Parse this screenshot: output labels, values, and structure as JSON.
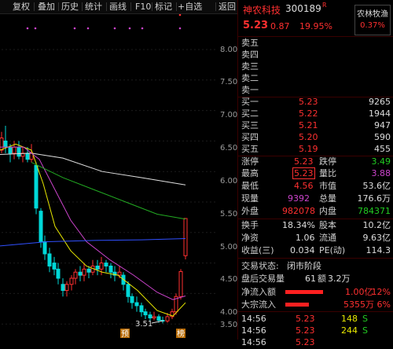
{
  "toolbar": {
    "items": [
      "复权",
      "叠加",
      "历史",
      "统计",
      "画线",
      "F10",
      "标记",
      "+自选",
      "返回"
    ]
  },
  "chart": {
    "y_ticks": [
      "8.00",
      "7.50",
      "7.00",
      "6.50",
      "6.00",
      "5.50",
      "5.00",
      "4.50",
      "4.00",
      "3.50"
    ],
    "low_label": "3.51",
    "badge_yu": "预",
    "badge_bang": "榜",
    "colors": {
      "up": "#ff3030",
      "down": "#00d8d8",
      "ma_white": "#e0e0e0",
      "ma_yellow": "#e8e800",
      "ma_purple": "#cc44cc",
      "ma_green": "#22aa22",
      "ma_blue": "#3050ff"
    }
  },
  "quote": {
    "name": "神农科技",
    "code": "300189",
    "r_mark": "R",
    "sector_name": "农林牧渔",
    "sector_pct": "0.37%",
    "price": "5.23",
    "change": "0.87",
    "change_pct": "19.95%"
  },
  "order_book": {
    "sells": [
      {
        "label": "卖五",
        "price": "",
        "vol": ""
      },
      {
        "label": "卖四",
        "price": "",
        "vol": ""
      },
      {
        "label": "卖三",
        "price": "",
        "vol": ""
      },
      {
        "label": "卖二",
        "price": "",
        "vol": ""
      },
      {
        "label": "卖一",
        "price": "",
        "vol": ""
      }
    ],
    "buys": [
      {
        "label": "买一",
        "price": "5.23",
        "vol": "9265"
      },
      {
        "label": "买二",
        "price": "5.22",
        "vol": "1944"
      },
      {
        "label": "买三",
        "price": "5.21",
        "vol": "947"
      },
      {
        "label": "买四",
        "price": "5.20",
        "vol": "590"
      },
      {
        "label": "买五",
        "price": "5.19",
        "vol": "455"
      }
    ]
  },
  "stats": {
    "limit_up_label": "涨停",
    "limit_up": "5.23",
    "limit_down_label": "跌停",
    "limit_down": "3.49",
    "high_label": "最高",
    "high": "5.23",
    "vol_ratio_label": "量比",
    "vol_ratio": "3.88",
    "low_label": "最低",
    "low": "4.56",
    "mkt_cap_label": "市值",
    "mkt_cap": "53.6亿",
    "now_vol_label": "现量",
    "now_vol": "9392",
    "total_vol_label": "总量",
    "total_vol": "176.6万",
    "outer_label": "外盘",
    "outer": "982078",
    "inner_label": "内盘",
    "inner": "784371",
    "turnover_label": "换手",
    "turnover": "18.34%",
    "equity_label": "股本",
    "equity": "10.2亿",
    "nav_label": "净资",
    "nav": "1.06",
    "float_label": "流通",
    "float_val": "9.63亿",
    "eps_label": "收益(三)",
    "eps": "0.034",
    "pe_label": "PE(动)",
    "pe": "114.3"
  },
  "trading": {
    "status_label": "交易状态:",
    "status": "闭市阶段",
    "after_label": "盘后交易量",
    "after_vol": "61",
    "after_amt_label": "额",
    "after_amt": "3.2万"
  },
  "flows": [
    {
      "label": "净流入额",
      "amount": "1.00亿",
      "pct": "12%",
      "bar": 0.85
    },
    {
      "label": "大宗流入",
      "amount": "5355万",
      "pct": "6%",
      "bar": 0.55
    }
  ],
  "ticks": [
    {
      "time": "14:56",
      "price": "5.23",
      "vol": "148",
      "flag": "S"
    },
    {
      "time": "14:56",
      "price": "5.23",
      "vol": "244",
      "flag": "S"
    },
    {
      "time": "14:56",
      "price": "5.23",
      "vol": "",
      "flag": ""
    }
  ]
}
